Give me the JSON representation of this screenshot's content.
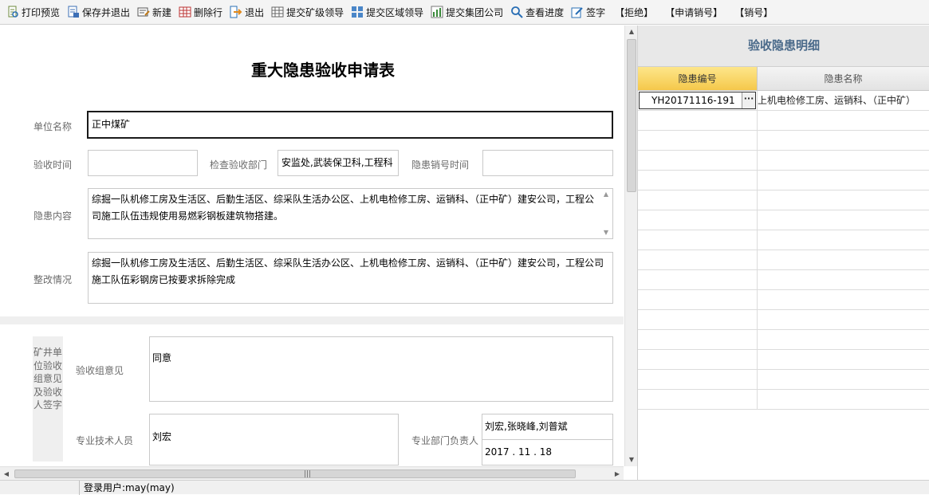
{
  "toolbar": {
    "items": [
      {
        "label": "打印预览",
        "icon": "print-preview-icon"
      },
      {
        "label": "保存并退出",
        "icon": "save-exit-icon"
      },
      {
        "label": "新建",
        "icon": "new-icon"
      },
      {
        "label": "删除行",
        "icon": "delete-row-icon"
      },
      {
        "label": "退出",
        "icon": "exit-icon"
      },
      {
        "label": "提交矿级领导",
        "icon": "grid-icon"
      },
      {
        "label": "提交区域领导",
        "icon": "org-icon"
      },
      {
        "label": "提交集团公司",
        "icon": "chart-icon"
      },
      {
        "label": "查看进度",
        "icon": "search-icon"
      },
      {
        "label": "签字",
        "icon": "pen-icon"
      }
    ],
    "bracket_items": [
      "【拒绝】",
      "【申请销号】",
      "【销号】"
    ]
  },
  "form": {
    "title": "重大隐患验收申请表",
    "unit_label": "单位名称",
    "unit_value": "正中煤矿",
    "accept_time_label": "验收时间",
    "accept_time_value": "",
    "dept_label": "检查验收部门",
    "dept_value": "安监处,武装保卫科,工程科",
    "cancel_time_label": "隐患销号时间",
    "cancel_time_value": "",
    "hazard_label": "隐患内容",
    "hazard_value": "综掘一队机修工房及生活区、后勤生活区、综采队生活办公区、上机电检修工房、运销科、（正中矿）建安公司，工程公司施工队伍违规使用易燃彩钢板建筑物搭建。",
    "rectify_label": "整改情况",
    "rectify_value": "综掘一队机修工房及生活区、后勤生活区、综采队生活办公区、上机电检修工房、运销科、（正中矿）建安公司，工程公司施工队伍彩钢房已按要求拆除完成",
    "side_label": "矿井单位验收组意见及验收人签字",
    "opinion_label": "验收组意见",
    "opinion_value": "同意",
    "tech_label": "专业技术人员",
    "tech_value": "刘宏",
    "leader_label": "专业部门负责人",
    "leader_value": "刘宏,张晓峰,刘普斌",
    "leader_date": "2017 . 11 . 18"
  },
  "detail_panel": {
    "title": "验收隐患明细",
    "columns": [
      "隐患编号",
      "隐患名称"
    ],
    "rows": [
      {
        "code": "YH20171116-191",
        "name": "上机电检修工房、运销科、（正中矿）"
      }
    ],
    "empty_rows": 15
  },
  "status": {
    "user_label": "登录用户:may(may)"
  }
}
